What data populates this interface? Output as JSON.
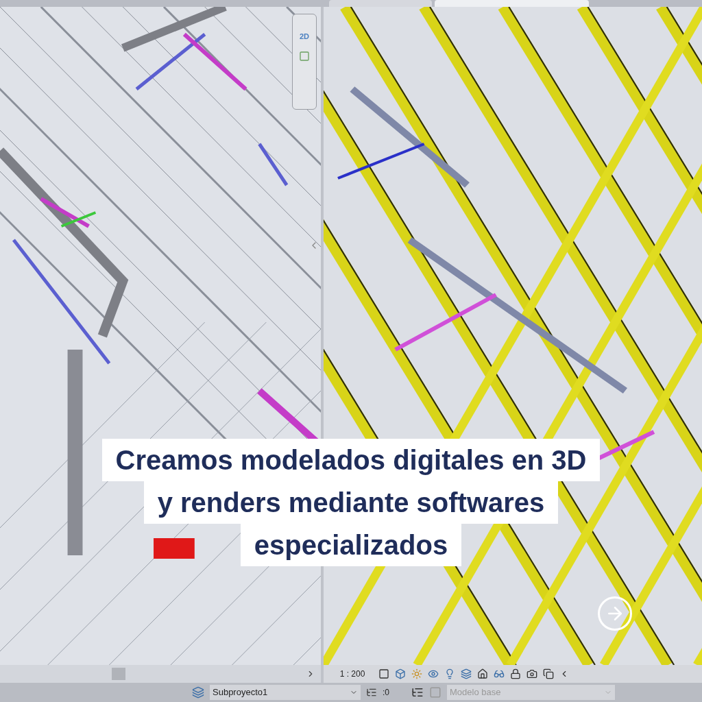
{
  "navigation_bar": {
    "label": "2D"
  },
  "view_control_bar": {
    "scale": "1 : 200"
  },
  "status_bar": {
    "workset": "Subproyecto1",
    "editable_count": ":0",
    "design_option": "Modelo base"
  },
  "caption": {
    "lines": [
      "Creamos modelados digitales en 3D",
      "y renders mediante softwares",
      "especializados"
    ]
  }
}
